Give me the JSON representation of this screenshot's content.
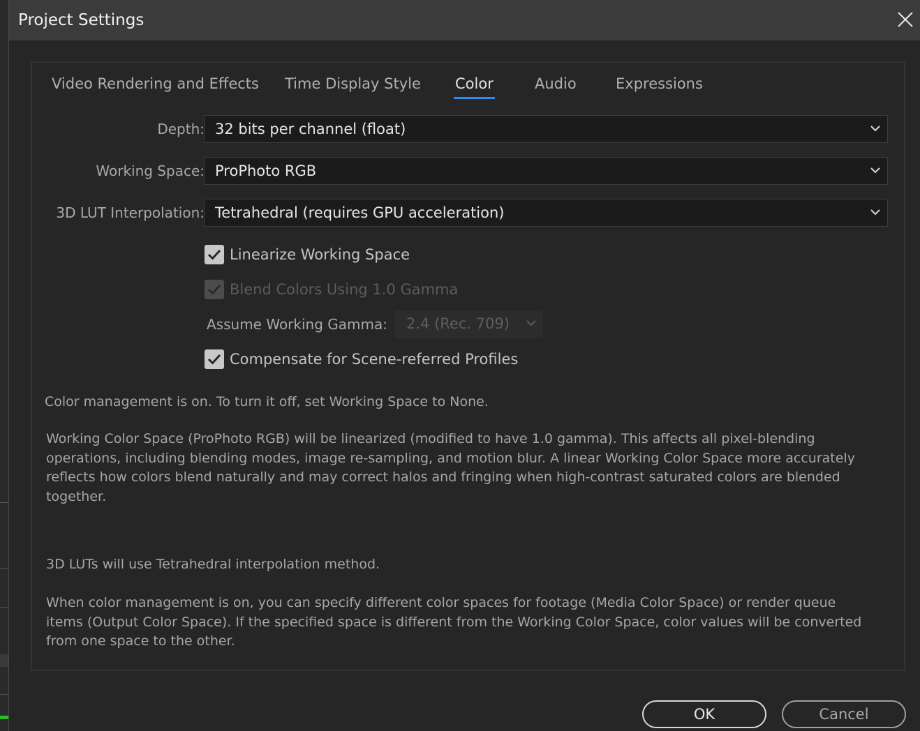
{
  "dialog": {
    "title": "Project Settings"
  },
  "tabs": [
    {
      "label": "Video Rendering and Effects",
      "active": false
    },
    {
      "label": "Time Display Style",
      "active": false
    },
    {
      "label": "Color",
      "active": true
    },
    {
      "label": "Audio",
      "active": false
    },
    {
      "label": "Expressions",
      "active": false
    }
  ],
  "color": {
    "depth_label": "Depth:",
    "depth_value": "32 bits per channel (float)",
    "working_space_label": "Working Space:",
    "working_space_value": "ProPhoto RGB",
    "lut_label": "3D LUT Interpolation:",
    "lut_value": "Tetrahedral (requires GPU acceleration)",
    "linearize_label": "Linearize Working Space",
    "linearize_checked": true,
    "blend_label": "Blend Colors Using 1.0 Gamma",
    "blend_checked": true,
    "blend_disabled": true,
    "gamma_label": "Assume Working Gamma:",
    "gamma_value": "2.4 (Rec. 709)",
    "gamma_disabled": true,
    "compensate_label": "Compensate for Scene-referred Profiles",
    "compensate_checked": true
  },
  "info": {
    "management": "Color management is on. To turn it off, set Working Space to None.",
    "linearized": "Working Color Space (ProPhoto RGB) will be linearized (modified to have 1.0 gamma). This affects all pixel-blending operations, including blending modes, image re-sampling, and motion blur. A linear Working Color Space more accurately reflects how colors blend naturally and may correct halos and fringing when high-contrast saturated colors are blended together.",
    "lut": "3D LUTs will use Tetrahedral interpolation method.",
    "spaces": "When color management is on, you can specify different color spaces for footage (Media Color Space) or render queue items (Output Color Space). If the specified space is different from the Working Color Space, color values will be converted from one space to the other."
  },
  "buttons": {
    "ok": "OK",
    "cancel": "Cancel"
  },
  "colors": {
    "accent": "#2d8ceb",
    "background": "#262626",
    "titlebar": "#3b3b3b"
  },
  "icons": {
    "close": "close-icon",
    "chevron": "chevron-down-icon",
    "check": "checkmark-icon"
  }
}
